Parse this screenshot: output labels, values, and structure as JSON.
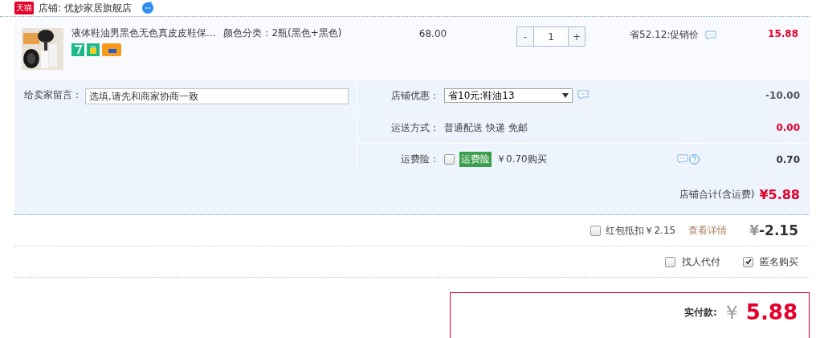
{
  "shop": {
    "badge": "天猫",
    "label": "店铺: 优妙家居旗舰店"
  },
  "item": {
    "title": "液体鞋油男黑色无色真皮皮鞋保...",
    "spec": "颜色分类：2瓶(黑色+黑色)",
    "price": "68.00",
    "quantity": {
      "minus": "-",
      "value": "1",
      "plus": "+"
    },
    "promo": "省52.12:促销价",
    "subtotal": "15.88"
  },
  "message": {
    "label": "给卖家留言：",
    "placeholder": "选填,请先和商家协商一致"
  },
  "options": [
    {
      "kind": "select",
      "label": "店铺优惠：",
      "value": "省10元:鞋油13",
      "amount": "-10.00",
      "color": "#555555"
    },
    {
      "kind": "text",
      "label": "运送方式：",
      "value": "普通配送 快递 免邮",
      "amount": "0.00",
      "color": "#e4002b"
    },
    {
      "kind": "insurance",
      "label": "运费险：",
      "checked": false,
      "tag": "运费险",
      "value": "￥0.70购买",
      "amount": "0.70",
      "color": "#333333"
    }
  ],
  "shop_total": {
    "label": "店铺合计(含运费)",
    "value": "¥5.88"
  },
  "red_packet": {
    "checked": false,
    "label": "红包抵扣￥2.15",
    "link": "查看详情",
    "currency": "¥",
    "value": "-2.15"
  },
  "extras": [
    {
      "label": "找人代付",
      "checked": false
    },
    {
      "label": "匿名购买",
      "checked": true
    }
  ],
  "pay": {
    "label": "实付款:",
    "currency": "￥",
    "value": "5.88"
  }
}
